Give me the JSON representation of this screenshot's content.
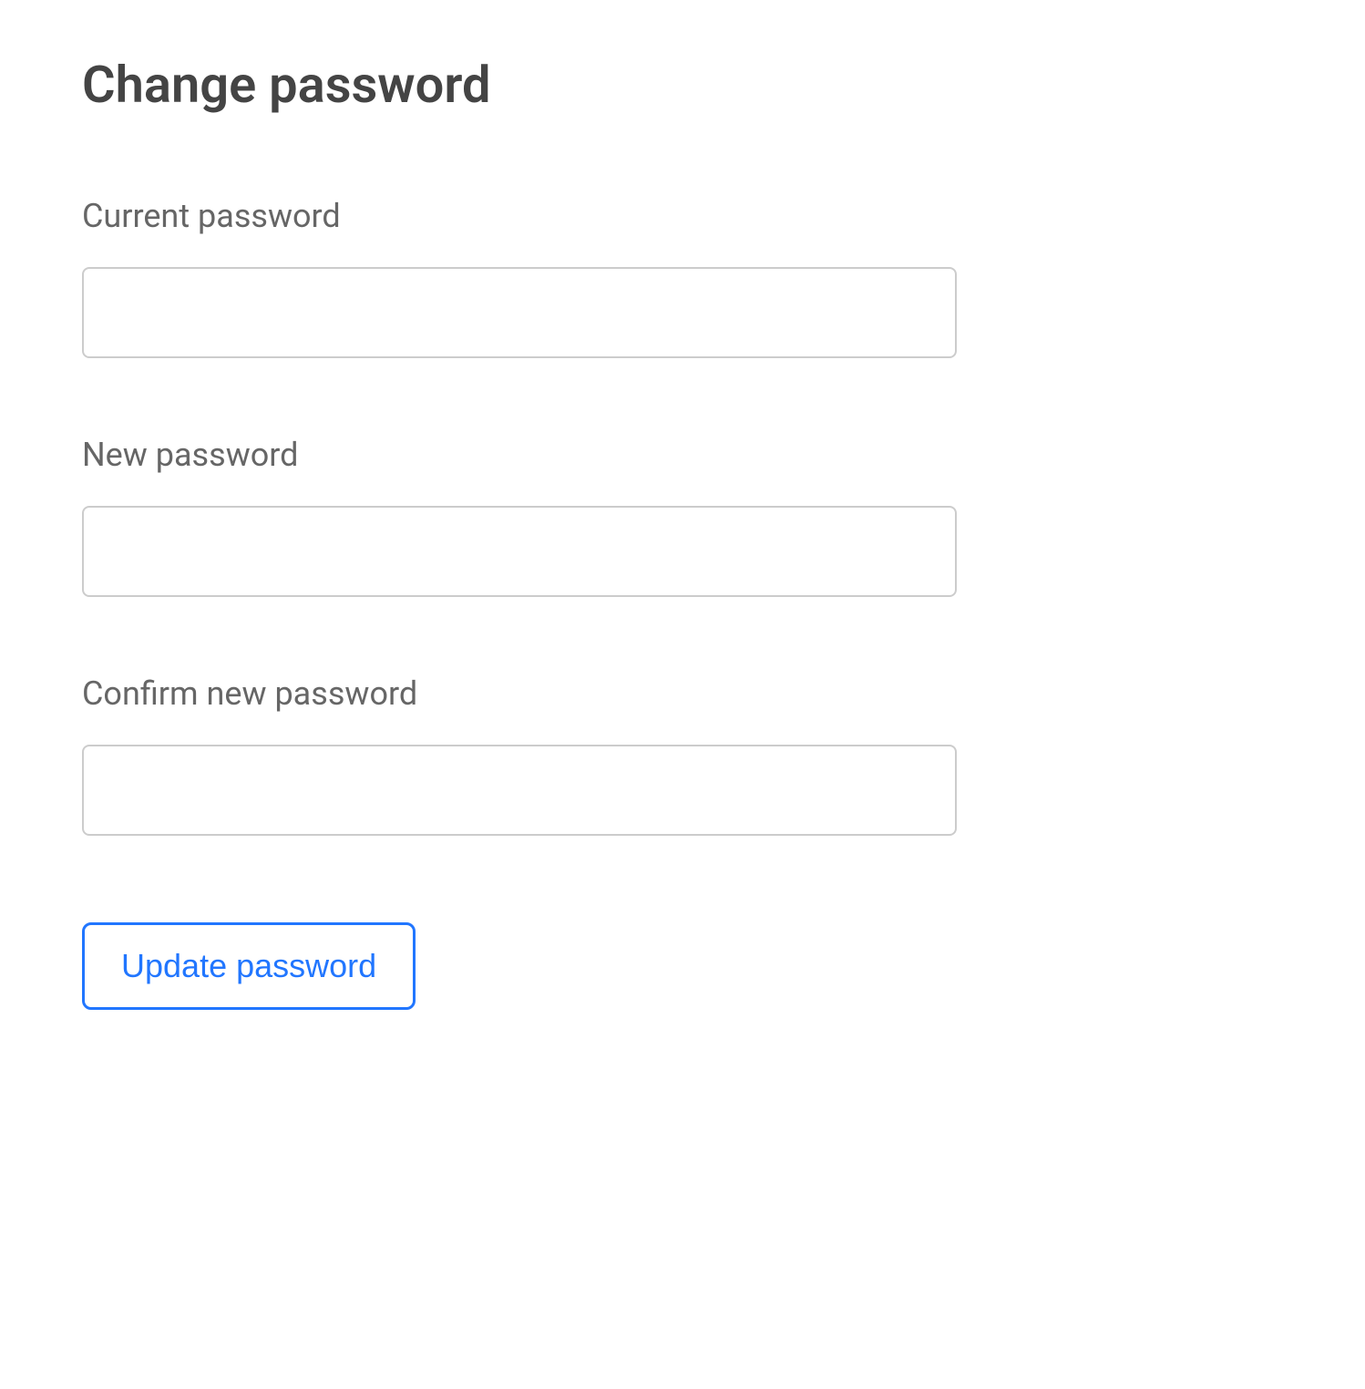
{
  "page": {
    "title": "Change password"
  },
  "form": {
    "fields": {
      "current_password": {
        "label": "Current password",
        "value": ""
      },
      "new_password": {
        "label": "New password",
        "value": ""
      },
      "confirm_password": {
        "label": "Confirm new password",
        "value": ""
      }
    },
    "submit_label": "Update password"
  }
}
